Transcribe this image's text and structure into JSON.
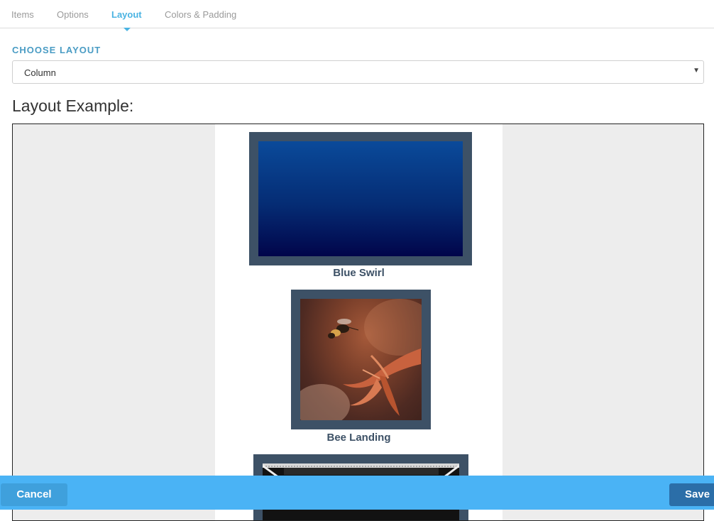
{
  "tabs": [
    {
      "label": "Items",
      "active": false
    },
    {
      "label": "Options",
      "active": false
    },
    {
      "label": "Layout",
      "active": true
    },
    {
      "label": "Colors & Padding",
      "active": false
    }
  ],
  "layout_section": {
    "label": "CHOOSE LAYOUT",
    "selected": "Column",
    "arrow_icon": "triangle-down-icon"
  },
  "example": {
    "heading": "Layout Example:",
    "items": [
      {
        "caption": "Blue Swirl",
        "image": "blue-swirl-image"
      },
      {
        "caption": "Bee Landing",
        "image": "bee-landing-image"
      },
      {
        "caption": "",
        "image": "architecture-image"
      }
    ]
  },
  "footer": {
    "cancel_label": "Cancel",
    "save_label": "Save"
  },
  "colors": {
    "accent": "#4ab3e2",
    "footer": "#4ab3f5",
    "frame": "#3d5166",
    "save_button": "#2b6ea8"
  }
}
